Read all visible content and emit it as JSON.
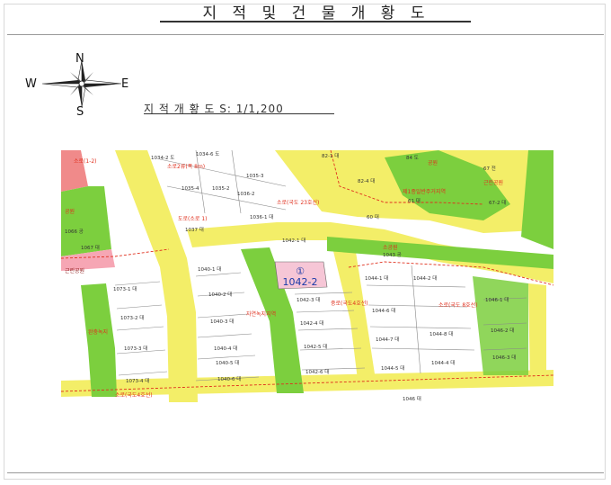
{
  "document": {
    "title": "지 적 및 건 물 개 황 도",
    "scale_text": "지 적 개 황 도 S: 1/1,200"
  },
  "compass": {
    "north": "N",
    "south": "S",
    "east": "E",
    "west": "W"
  },
  "map": {
    "target_marker": "①",
    "target_parcel": "1042-2",
    "parcels": {
      "p1034_2": "1034-2 도",
      "p1034_6": "1034-6 도",
      "p1035_4": "1035-4",
      "p1035_2": "1035-2",
      "p1035_3": "1035-3",
      "p1036_2": "1036-2",
      "p1036_1": "1036-1 대",
      "p1037": "1037 대",
      "p82_1": "82-1 대",
      "p82_4": "82-4 대",
      "p84": "84 도",
      "p67": "67 전",
      "p61": "61 대",
      "p60": "60 대",
      "p67_2": "67-2 대",
      "p1066": "1066 공",
      "p1067": "1067 대",
      "p1042_1": "1042-1 대",
      "p1043": "1043 공",
      "p1040_1": "1040-1 대",
      "p1040_2": "1040-2 대",
      "p1040_3": "1040-3 대",
      "p1040_4": "1040-4 대",
      "p1040_5": "1040-5 대",
      "p1040_6": "1040-6 대",
      "p1042_3": "1042-3 대",
      "p1042_4": "1042-4 대",
      "p1042_5": "1042-5 대",
      "p1042_6": "1042-6 대",
      "p1044_1": "1044-1 대",
      "p1044_2": "1044-2 대",
      "p1044_6": "1044-6 대",
      "p1044_7": "1044-7 대",
      "p1044_8": "1044-8 대",
      "p1044_5": "1044-5 대",
      "p1044_4": "1044-4 대",
      "p1073_1": "1073-1 대",
      "p1073_2": "1073-2 대",
      "p1073_3": "1073-3 대",
      "p1073_4": "1073-4 대",
      "p1046_1": "1046-1 대",
      "p1046_2": "1046-2 대",
      "p1046_3": "1046-3 대",
      "p1046": "1046 대"
    },
    "zones": {
      "z1": "소로2류(폭 8m)",
      "z2": "제1종일반주거지역",
      "z3": "공원",
      "z4": "소로(1-2)",
      "z5": "소로(국도 23호선)",
      "z6": "도로(소로 1)",
      "z7": "근린공원",
      "z8": "자연녹지지역",
      "z9": "중로(국도4호선)",
      "z10": "소로(국도 8호선)",
      "z11": "소공원",
      "z12": "완충녹지",
      "z13": "공원",
      "z14": "근린공원",
      "z15": "소로(국도4호선)"
    }
  }
}
